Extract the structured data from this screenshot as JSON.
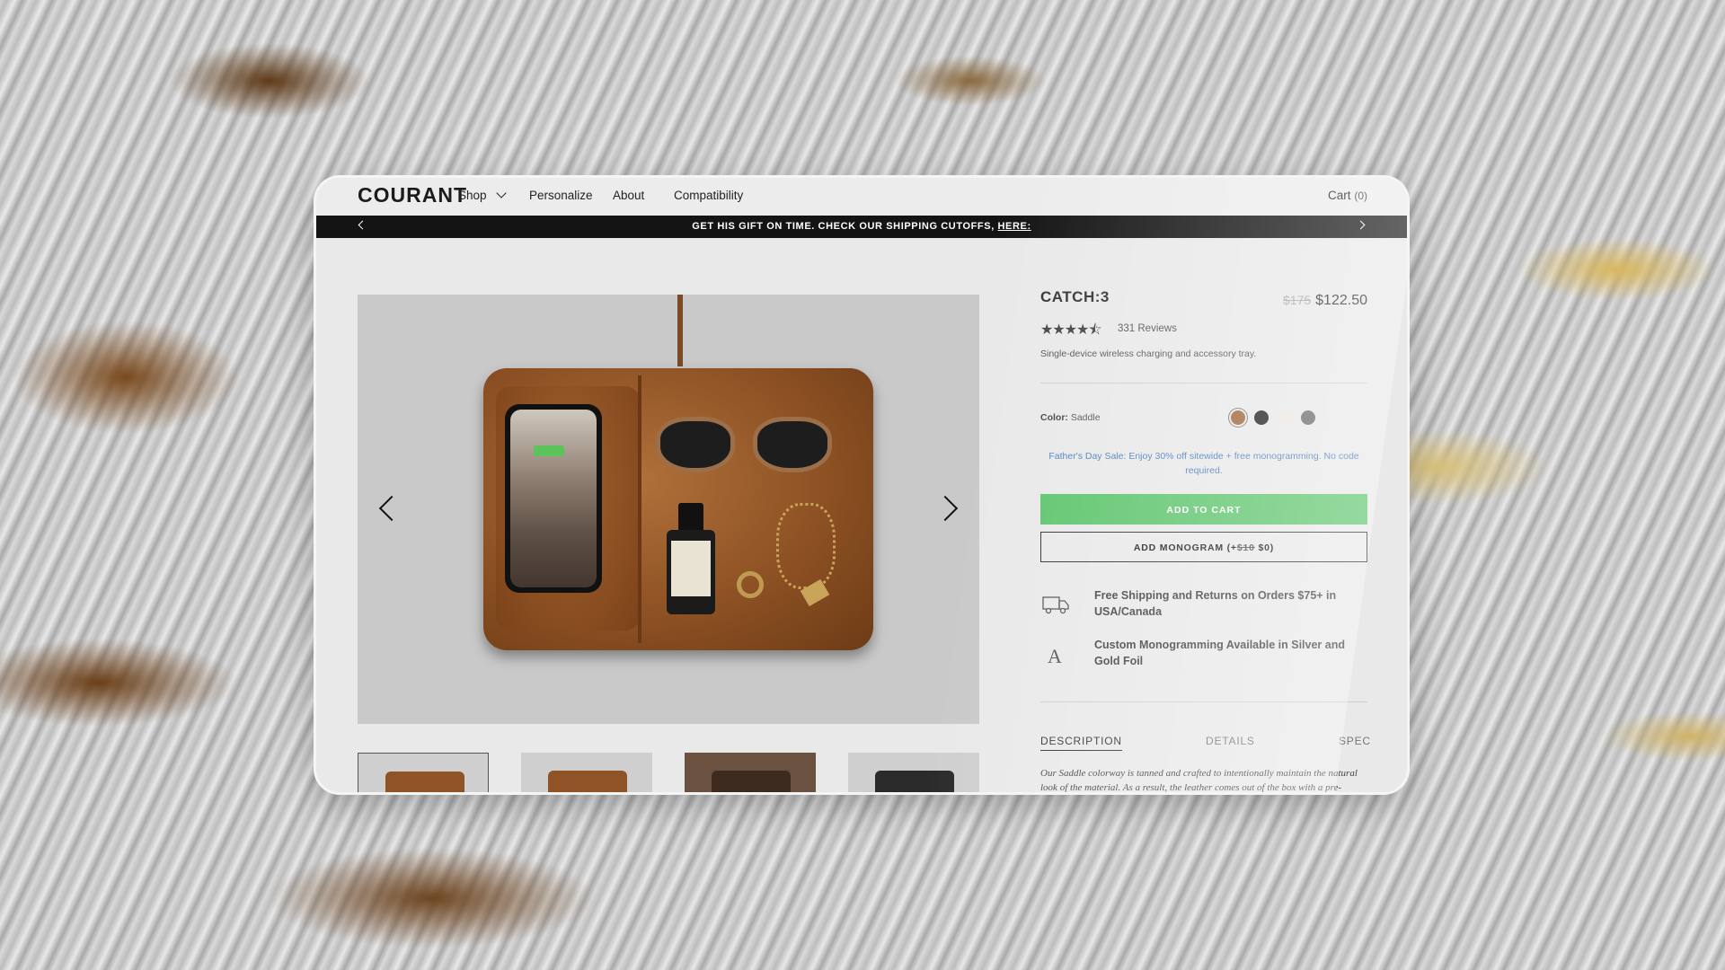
{
  "nav": {
    "logo": "COURANT",
    "items": [
      "Shop",
      "Personalize",
      "About",
      "Compatibility"
    ],
    "cart_label": "Cart",
    "cart_count": "(0)"
  },
  "banner": {
    "text": "GET HIS GIFT ON TIME. CHECK OUR SHIPPING CUTOFFS,",
    "link": "HERE:"
  },
  "product": {
    "title": "CATCH:3",
    "original_price": "$175",
    "price": "$122.50",
    "rating": 4.5,
    "stars": "★★★★⯪",
    "reviews": "331 Reviews",
    "short_desc": "Single-device wireless charging and accessory tray.",
    "color_label": "Color:",
    "color_value": "Saddle",
    "swatches": [
      "#a0673a",
      "#222222",
      "#ece8df",
      "#6a6a6a"
    ],
    "sale_text": "Father's Day Sale: Enjoy 30% off sitewide + free monogramming. No code required.",
    "add_to_cart": "ADD TO CART",
    "monogram_prefix": "ADD MONOGRAM (+",
    "monogram_old": "$10",
    "monogram_new": " $0)",
    "features": [
      {
        "icon": "truck-icon",
        "text": "Free Shipping and Returns on Orders $75+ in USA/Canada"
      },
      {
        "icon": "monogram-letter-icon",
        "text": "Custom Monogramming Available in Silver and Gold Foil"
      }
    ],
    "tabs": [
      "DESCRIPTION",
      "DETAILS",
      "SPEC"
    ],
    "description": "Our Saddle colorway is tanned and crafted to intentionally maintain the natural look of the material. As a result, the leather comes out of the box with a pre-"
  },
  "colors": {
    "add_to_cart_bg": "#5fc56e",
    "sale_text": "#4a7fbf",
    "banner_bg": "#141414"
  }
}
